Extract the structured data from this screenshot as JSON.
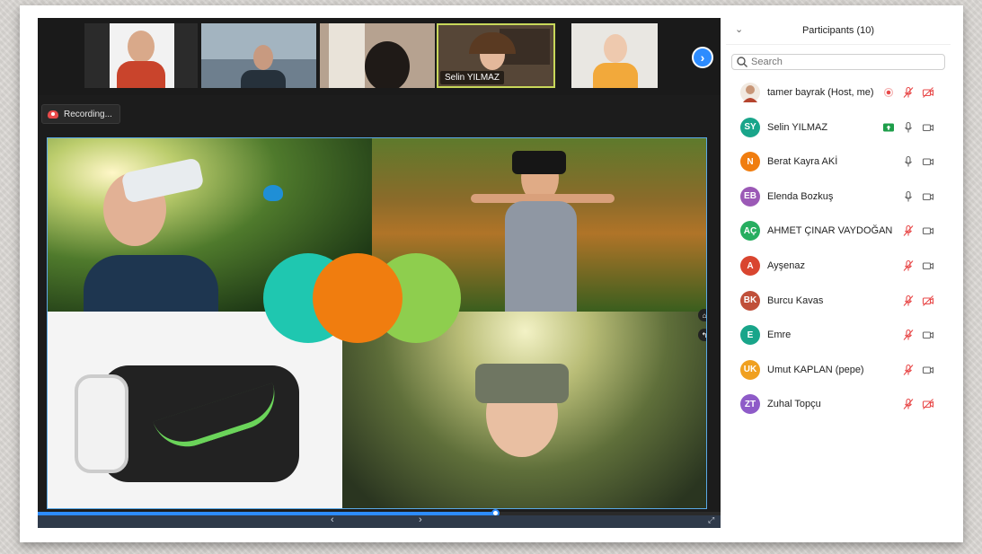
{
  "header": {
    "title": "Participants (10)",
    "collapse_icon": "chevron-down-icon"
  },
  "search": {
    "placeholder": "Search",
    "value": ""
  },
  "recording_label": "Recording...",
  "active_speaker_name": "Selin YILMAZ",
  "controls": {
    "prev_label": "‹",
    "next_label": "›",
    "strip_next_label": "›"
  },
  "share_progress": 0.67,
  "colors": {
    "accent": "#2d8cff",
    "active_outline": "#c8d75a",
    "muted": "#e84a4a"
  },
  "participants": [
    {
      "name": "tamer bayrak (Host, me)",
      "initials": "",
      "avatar_color": "#8b6a4a",
      "photo": true,
      "recording_dot": true,
      "share_icon": false,
      "mic": "muted-red",
      "video": "off-red"
    },
    {
      "name": "Selin YILMAZ",
      "initials": "SY",
      "avatar_color": "#19a58a",
      "photo": false,
      "recording_dot": false,
      "share_icon": true,
      "mic": "on",
      "video": "on"
    },
    {
      "name": "Berat Kayra AKİ",
      "initials": "N",
      "avatar_color": "#f07d0f",
      "photo": false,
      "recording_dot": false,
      "share_icon": false,
      "mic": "on",
      "video": "on"
    },
    {
      "name": "Elenda Bozkuş",
      "initials": "EB",
      "avatar_color": "#9b59b6",
      "photo": false,
      "recording_dot": false,
      "share_icon": false,
      "mic": "on",
      "video": "on"
    },
    {
      "name": "AHMET ÇINAR VAYDOĞAN",
      "initials": "AÇ",
      "avatar_color": "#27ae60",
      "photo": false,
      "recording_dot": false,
      "share_icon": false,
      "mic": "muted-red",
      "video": "on"
    },
    {
      "name": "Ayşenaz",
      "initials": "A",
      "avatar_color": "#d9452f",
      "photo": false,
      "recording_dot": false,
      "share_icon": false,
      "mic": "muted-red",
      "video": "on"
    },
    {
      "name": "Burcu Kavas",
      "initials": "BK",
      "avatar_color": "#c0503a",
      "photo": false,
      "recording_dot": false,
      "share_icon": false,
      "mic": "muted-red",
      "video": "off-red"
    },
    {
      "name": "Emre",
      "initials": "E",
      "avatar_color": "#19a58a",
      "photo": false,
      "recording_dot": false,
      "share_icon": false,
      "mic": "muted-red",
      "video": "on"
    },
    {
      "name": "Umut KAPLAN (pepe)",
      "initials": "UK",
      "avatar_color": "#f0a020",
      "photo": false,
      "recording_dot": false,
      "share_icon": false,
      "mic": "muted-red",
      "video": "on"
    },
    {
      "name": "Zuhal Topçu",
      "initials": "ZT",
      "avatar_color": "#8e5bc8",
      "photo": false,
      "recording_dot": false,
      "share_icon": false,
      "mic": "muted-red",
      "video": "off-red"
    }
  ]
}
